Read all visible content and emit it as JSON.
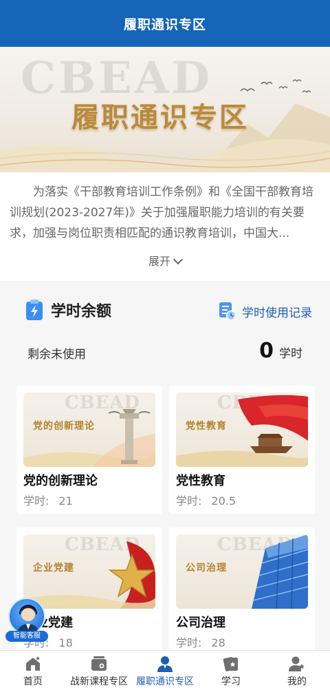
{
  "header": {
    "title": "履职通识专区"
  },
  "banner": {
    "watermark": "CBEAD",
    "title": "履职通识专区"
  },
  "intro": {
    "text": "为落实《干部教育培训工作条例》和《全国干部教育培训规划(2023-2027年)》关于加强履职能力培训的有关要求，加强与岗位职责相匹配的通识教育培训，中国大...",
    "expand_label": "展开"
  },
  "balance": {
    "title": "学时余额",
    "record_link": "学时使用记录",
    "remaining_label": "剩余未使用",
    "remaining_value": "0",
    "unit": "学时"
  },
  "courses": [
    {
      "name": "党的创新理论",
      "image_label": "党的创新理论",
      "watermark": "CBEAD",
      "hours_label": "学时:",
      "hours": "21"
    },
    {
      "name": "党性教育",
      "image_label": "党性教育",
      "watermark": "CBEAD",
      "hours_label": "学时:",
      "hours": "20.5"
    },
    {
      "name": "企业党建",
      "image_label": "企业党建",
      "watermark": "CBEAD",
      "hours_label": "学时:",
      "hours": "18"
    },
    {
      "name": "公司治理",
      "image_label": "公司治理",
      "watermark": "CBEAD",
      "hours_label": "学时:",
      "hours": "28"
    }
  ],
  "customer_service": {
    "label": "智能客服",
    "icon": "customer-service-avatar"
  },
  "tabs": [
    {
      "label": "首页",
      "icon": "home-icon",
      "active": false
    },
    {
      "label": "战新课程专区",
      "icon": "tv-icon",
      "active": false
    },
    {
      "label": "履职通识专区",
      "icon": "user-icon",
      "active": true
    },
    {
      "label": "学习",
      "icon": "book-icon",
      "active": false
    },
    {
      "label": "我的",
      "icon": "profile-icon",
      "active": false
    }
  ],
  "colors": {
    "primary": "#1565b8",
    "link": "#1f5fb0",
    "gold": "#b98a3e",
    "background": "#f6f6f6"
  }
}
